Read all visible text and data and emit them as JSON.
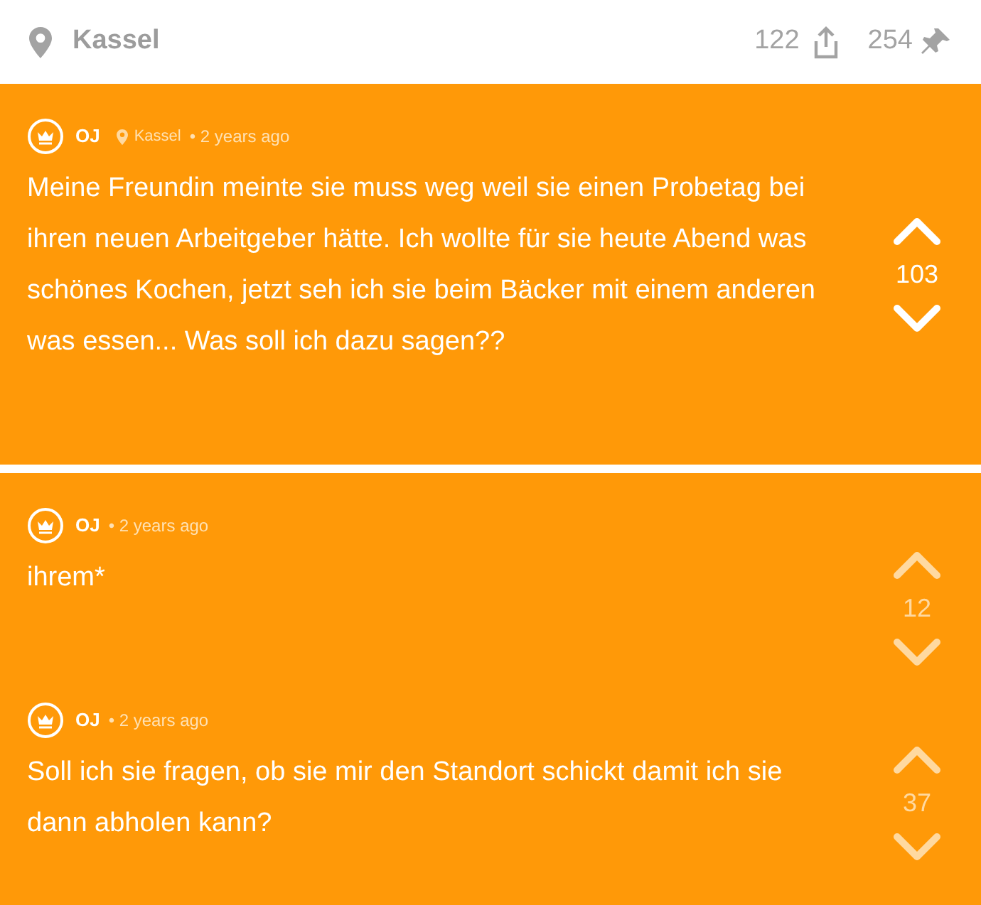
{
  "header": {
    "location": "Kassel",
    "share_count": "122",
    "pin_count": "254"
  },
  "posts": [
    {
      "kind": "post",
      "author": "OJ",
      "location": "Kassel",
      "time": "• 2 years ago",
      "text": "Meine Freundin meinte sie muss weg weil sie einen Probetag bei ihren neuen Arbeitgeber hätte. Ich wollte für sie heute Abend was schönes Kochen, jetzt seh ich sie beim Bäcker mit einem anderen was essen... Was soll ich dazu sagen??",
      "votes": "103"
    },
    {
      "kind": "reply",
      "author": "OJ",
      "time": "• 2 years ago",
      "text": "ihrem*",
      "votes": "12"
    },
    {
      "kind": "reply",
      "author": "OJ",
      "time": "• 2 years ago",
      "text": "Soll ich sie fragen, ob sie mir den Standort schickt damit ich sie dann abholen kann?",
      "votes": "37"
    }
  ]
}
